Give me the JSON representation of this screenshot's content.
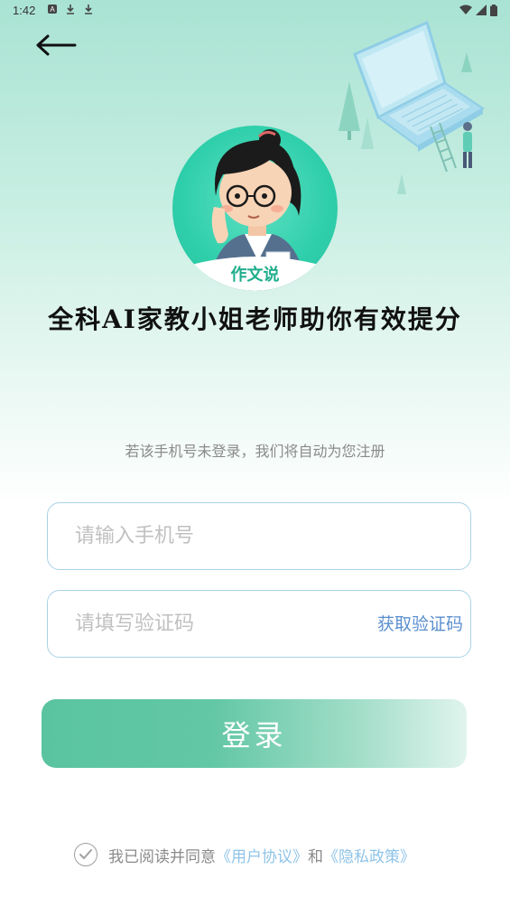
{
  "status_bar": {
    "time": "1:42",
    "icons": [
      "app-store-icon",
      "download-icon",
      "download-icon"
    ],
    "right_icons": [
      "wifi-icon",
      "signal-icon",
      "battery-icon"
    ]
  },
  "header": {
    "back_icon": "arrow-left-icon"
  },
  "brand": {
    "logo_text": "作文说",
    "tagline": "全科AI家教小姐老师助你有效提分",
    "accent_color": "#2fcfab"
  },
  "form": {
    "notice": "若该手机号未登录，我们将自动为您注册",
    "phone_placeholder": "请输入手机号",
    "phone_value": "",
    "code_placeholder": "请填写验证码",
    "code_value": "",
    "get_code_label": "获取验证码",
    "login_label": "登录",
    "login_color": "#5ac4a0"
  },
  "agreement": {
    "prefix": "我已阅读并同意",
    "user_agreement": "《用户协议》",
    "conjunction": "和",
    "privacy_policy": "《隐私政策》",
    "checked": false
  }
}
